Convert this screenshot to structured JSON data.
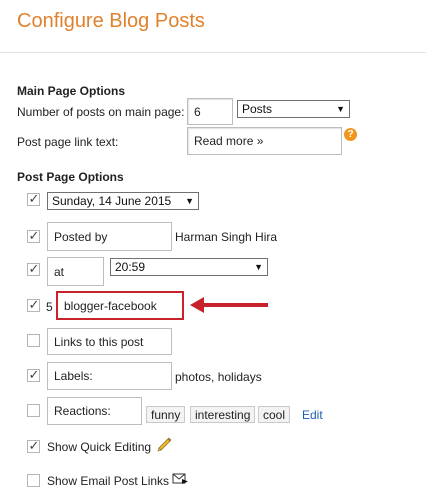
{
  "header": {
    "title": "Configure Blog Posts"
  },
  "main_page": {
    "heading": "Main Page Options",
    "posts_label": "Number of posts on main page:",
    "posts_value": "6",
    "posts_unit": "Posts",
    "link_label": "Post page link text:",
    "link_value": "Read more »",
    "help_glyph": "?"
  },
  "post_page": {
    "heading": "Post Page Options",
    "date_value": "Sunday, 14 June 2015",
    "posted_by_value": "Posted by",
    "author_name": "Harman Singh Hira",
    "at_value": "at",
    "time_value": "20:59",
    "share_prefix": "5",
    "share_value": "blogger-facebook",
    "links_value": "Links to this post",
    "labels_value": "Labels:",
    "labels_list": "photos, holidays",
    "reactions_value": "Reactions:",
    "reaction_tags": [
      "funny",
      "interesting",
      "cool"
    ],
    "edit_link": "Edit",
    "quick_edit_label": "Show Quick Editing",
    "email_label": "Show Email Post Links"
  },
  "colors": {
    "title": "#e0822c",
    "highlight": "#c8232b",
    "help": "#f0961f",
    "link": "#1a5fb4"
  },
  "icons": {
    "quick_edit": "pencil-icon",
    "email": "email-forward-icon",
    "help": "help-icon",
    "dropdown": "chevron-down-icon"
  }
}
